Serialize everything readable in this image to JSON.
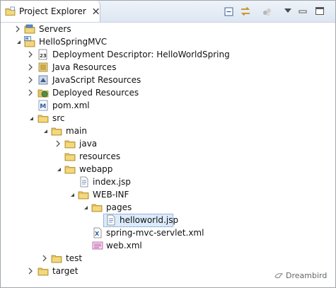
{
  "view": {
    "title": "Project Explorer"
  },
  "tree": [
    {
      "name": "tree-item-servers",
      "label": "Servers",
      "expanded": false,
      "icon": "server-folder-icon"
    },
    {
      "name": "tree-item-hellospringmvc",
      "label": "HelloSpringMVC",
      "expanded": true,
      "icon": "maven-web-project-icon"
    },
    {
      "name": "tree-item-deployment-descriptor",
      "label": "Deployment Descriptor: HelloWorldSpring",
      "expanded": false,
      "icon": "deployment-descriptor-icon"
    },
    {
      "name": "tree-item-java-resources",
      "label": "Java Resources",
      "expanded": false,
      "icon": "java-resources-icon"
    },
    {
      "name": "tree-item-javascript-resources",
      "label": "JavaScript Resources",
      "expanded": false,
      "icon": "javascript-resources-icon"
    },
    {
      "name": "tree-item-deployed-resources",
      "label": "Deployed Resources",
      "expanded": false,
      "icon": "deployed-resources-icon"
    },
    {
      "name": "tree-item-pom-xml",
      "label": "pom.xml",
      "expanded": null,
      "icon": "maven-pom-file-icon"
    },
    {
      "name": "tree-item-src",
      "label": "src",
      "expanded": true,
      "icon": "folder-icon"
    },
    {
      "name": "tree-item-main",
      "label": "main",
      "expanded": true,
      "icon": "folder-icon"
    },
    {
      "name": "tree-item-java",
      "label": "java",
      "expanded": false,
      "icon": "folder-icon"
    },
    {
      "name": "tree-item-resources",
      "label": "resources",
      "expanded": null,
      "icon": "folder-icon"
    },
    {
      "name": "tree-item-webapp",
      "label": "webapp",
      "expanded": true,
      "icon": "folder-icon"
    },
    {
      "name": "tree-item-index-jsp",
      "label": "index.jsp",
      "expanded": null,
      "icon": "jsp-file-icon"
    },
    {
      "name": "tree-item-web-inf",
      "label": "WEB-INF",
      "expanded": true,
      "icon": "folder-icon"
    },
    {
      "name": "tree-item-pages",
      "label": "pages",
      "expanded": true,
      "icon": "folder-icon"
    },
    {
      "name": "tree-item-helloworld-jsp",
      "label": "helloworld.jsp",
      "expanded": null,
      "icon": "jsp-file-icon",
      "selected": true
    },
    {
      "name": "tree-item-spring-mvc-servlet-xml",
      "label": "spring-mvc-servlet.xml",
      "expanded": null,
      "icon": "xml-file-icon"
    },
    {
      "name": "tree-item-web-xml",
      "label": "web.xml",
      "expanded": null,
      "icon": "web-xml-file-icon"
    },
    {
      "name": "tree-item-test",
      "label": "test",
      "expanded": false,
      "icon": "folder-icon"
    },
    {
      "name": "tree-item-target",
      "label": "target",
      "expanded": false,
      "icon": "folder-icon"
    }
  ],
  "watermark": {
    "text": "Dreambird"
  }
}
